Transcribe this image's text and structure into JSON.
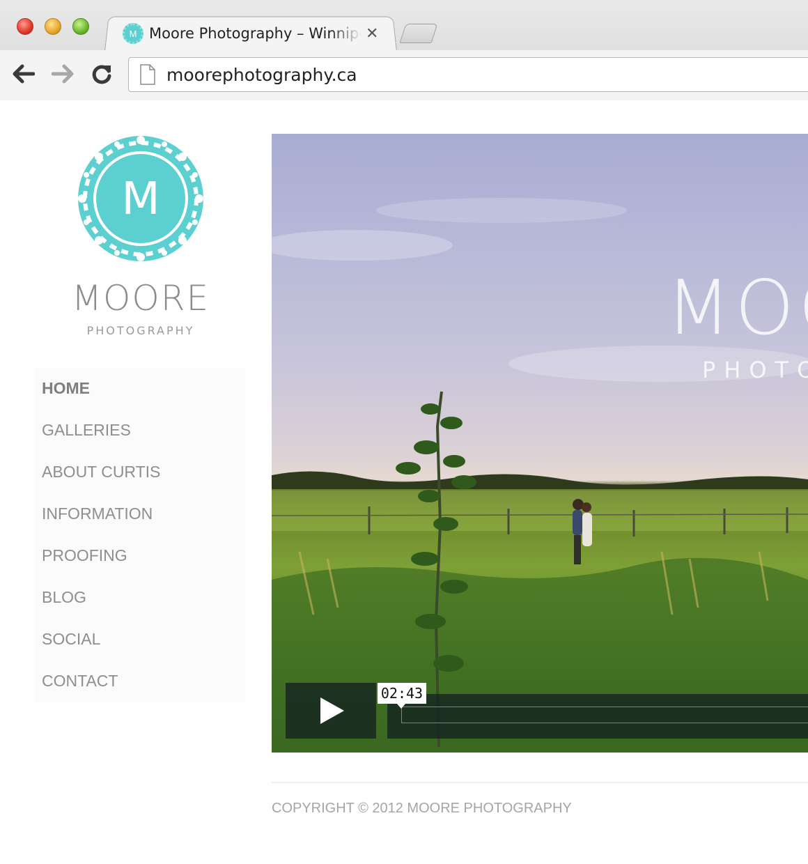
{
  "browser": {
    "tab_title": "Moore Photography – Winnipeg Wedding Photographer",
    "tab_close_glyph": "✕",
    "favicon_letter": "M",
    "url": "moorephotography.ca",
    "icons": {
      "back": "arrow-left-icon",
      "forward": "arrow-right-icon",
      "reload": "reload-icon",
      "page": "page-icon"
    }
  },
  "brand": {
    "monogram": "M",
    "name": "MOORE",
    "subtitle": "PHOTOGRAPHY",
    "accent_color": "#5ccfd0"
  },
  "nav": {
    "items": [
      {
        "label": "HOME",
        "active": true
      },
      {
        "label": "GALLERIES",
        "active": false
      },
      {
        "label": "ABOUT CURTIS",
        "active": false
      },
      {
        "label": "INFORMATION",
        "active": false
      },
      {
        "label": "PROOFING",
        "active": false
      },
      {
        "label": "BLOG",
        "active": false
      },
      {
        "label": "SOCIAL",
        "active": false
      },
      {
        "label": "CONTACT",
        "active": false
      }
    ]
  },
  "video": {
    "overlay_title": "MOORE",
    "overlay_subtitle": "PHOTOGRAPHY",
    "time": "02:43",
    "progress": 0
  },
  "footer": {
    "copyright": "COPYRIGHT © 2012 MOORE PHOTOGRAPHY"
  }
}
